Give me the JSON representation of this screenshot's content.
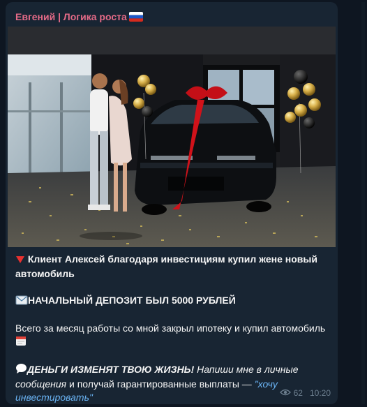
{
  "message": {
    "sender": "Евгений | Логика роста",
    "headline": "Клиент Алексей благодаря инвестициям купил жене новый автомобиль",
    "deposit": "НАЧАЛЬНЫЙ ДЕПОЗИТ БЫЛ 5000 РУБЛЕЙ",
    "body": "Всего за месяц работы со мной закрыл ипотеку и купил автомобиль",
    "cta_bold": "ДЕНЬГИ ИЗМЕНЯТ ТВОЮ ЖИЗНЬ!",
    "cta_italic": "Напиши мне в личные сообщения",
    "cta_plain": " и получай гарантированные выплаты — ",
    "cta_link": "\"хочу инвестировать\"",
    "views": "62",
    "time": "10:20"
  },
  "icons": {
    "sender_flag": "russia-flag-icon",
    "headline": "red-triangle-down-icon",
    "deposit": "envelope-icon",
    "body": "calendar-icon",
    "cta": "speech-bubble-icon",
    "views": "eye-icon"
  },
  "colors": {
    "sender": "#e46a87",
    "link": "#6ab3f3",
    "bubble": "#182533",
    "background": "#0e1621"
  }
}
